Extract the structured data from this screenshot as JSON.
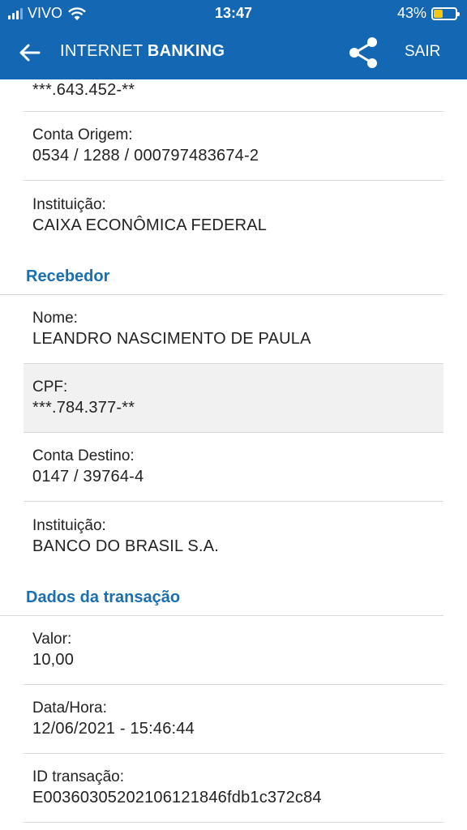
{
  "status_bar": {
    "carrier": "VIVO",
    "time": "13:47",
    "battery": "43%",
    "battery_level": 0.43
  },
  "nav": {
    "title_light": "INTERNET",
    "title_bold": "BANKING",
    "logout_label": "SAIR"
  },
  "origin": {
    "cpf_value": "***.643.452-**",
    "account_label": "Conta Origem:",
    "account_value": "0534 / 1288 / 000797483674-2",
    "institution_label": "Instituição:",
    "institution_value": "CAIXA ECONÔMICA FEDERAL"
  },
  "receiver": {
    "heading": "Recebedor",
    "name_label": "Nome:",
    "name_value": "LEANDRO NASCIMENTO DE PAULA",
    "cpf_label": "CPF:",
    "cpf_value": "***.784.377-**",
    "account_label": "Conta Destino:",
    "account_value": "0147 / 39764-4",
    "institution_label": "Instituição:",
    "institution_value": "BANCO DO BRASIL S.A."
  },
  "transaction": {
    "heading": "Dados da transação",
    "value_label": "Valor:",
    "value_value": "10,00",
    "datetime_label": "Data/Hora:",
    "datetime_value": "12/06/2021 - 15:46:44",
    "id_label": "ID transação:",
    "id_value": "E00360305202106121846fdb1c372c84"
  }
}
